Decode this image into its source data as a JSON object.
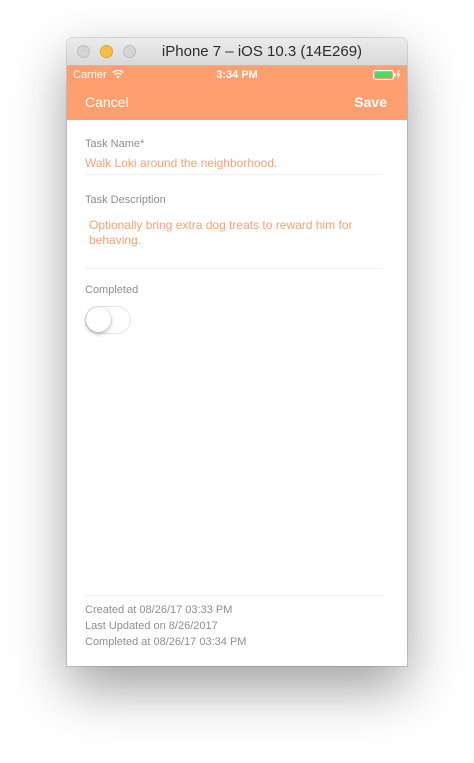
{
  "window": {
    "title": "iPhone 7 – iOS 10.3 (14E269)"
  },
  "status_bar": {
    "carrier": "Carrier",
    "time": "3:34 PM"
  },
  "nav": {
    "cancel_label": "Cancel",
    "save_label": "Save"
  },
  "form": {
    "task_name_label": "Task Name*",
    "task_name_value": "Walk Loki around the neighborhood.",
    "task_description_label": "Task Description",
    "task_description_value": "Optionally bring extra dog treats to reward him for behaving.",
    "completed_label": "Completed",
    "completed_on": false
  },
  "footer": {
    "created": "Created at 08/26/17 03:33 PM",
    "updated": "Last Updated on 8/26/2017",
    "completed": "Completed at 08/26/17 03:34 PM"
  },
  "colors": {
    "accent": "#ff9f70",
    "label_gray": "#8e8e93",
    "battery_green": "#4cd964"
  }
}
